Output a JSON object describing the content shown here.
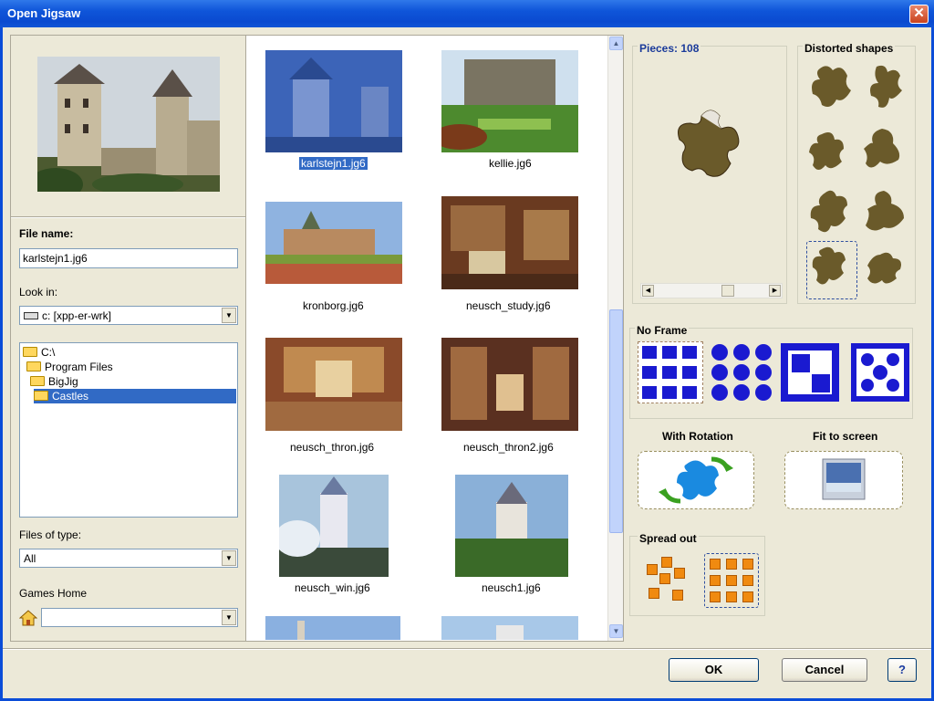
{
  "window": {
    "title": "Open Jigsaw",
    "close_glyph": "✕"
  },
  "left": {
    "file_name_label": "File name:",
    "file_name_value": "karlstejn1.jg6",
    "look_in_label": "Look in:",
    "look_in_value": "c: [xpp-er-wrk]",
    "tree": [
      "C:\\",
      "Program Files",
      "BigJig",
      "Castles"
    ],
    "files_of_type_label": "Files of type:",
    "files_of_type_value": "All",
    "games_home_label": "Games Home",
    "games_home_value": ""
  },
  "thumbnails": [
    {
      "name": "karlstejn1.jg6",
      "selected": true
    },
    {
      "name": "kellie.jg6"
    },
    {
      "name": "kronborg.jg6"
    },
    {
      "name": "neusch_study.jg6"
    },
    {
      "name": "neusch_thron.jg6"
    },
    {
      "name": "neusch_thron2.jg6"
    },
    {
      "name": "neusch_win.jg6"
    },
    {
      "name": "neusch1.jg6"
    }
  ],
  "options": {
    "pieces_label": "Pieces: 108",
    "distorted_label": "Distorted shapes",
    "frame_label": "No Frame",
    "rotation_label": "With Rotation",
    "fit_label": "Fit to screen",
    "spread_label": "Spread out"
  },
  "buttons": {
    "ok": "OK",
    "cancel": "Cancel",
    "help": "?"
  },
  "colors": {
    "title_bar": "#0b4dd8",
    "selection": "#316ac5",
    "piece_blue": "#1a1ad0",
    "spread_orange": "#f08a10"
  }
}
